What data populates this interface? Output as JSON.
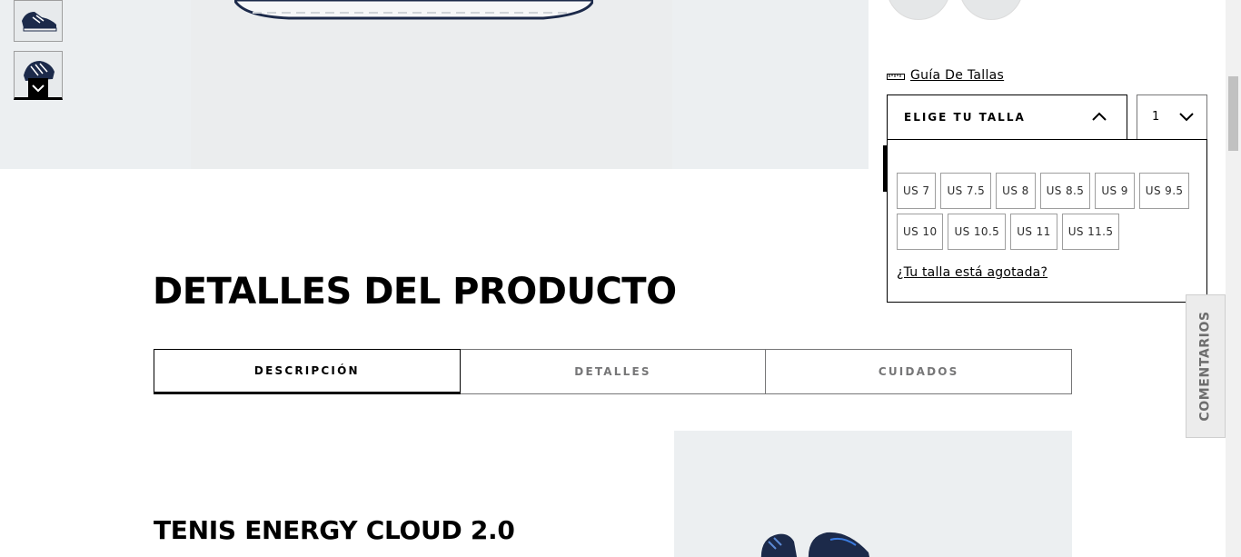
{
  "gallery": {
    "thumbnails": [
      {
        "icon": "shoe-side-icon"
      },
      {
        "icon": "shoe-angle-icon"
      }
    ],
    "scroll_icon": "chevron-down-icon"
  },
  "buy_panel": {
    "size_guide_icon": "ruler-icon",
    "size_guide_label": "Guía De Tallas",
    "size_select_label": "ELIGE TU TALLA",
    "size_select_icon": "chevron-up-icon",
    "quantity_value": "1",
    "quantity_icon": "chevron-down-icon",
    "sizes": [
      "US 7",
      "US 7.5",
      "US 8",
      "US 8.5",
      "US 9",
      "US 9.5",
      "US 10",
      "US 10.5",
      "US 11",
      "US 11.5"
    ],
    "sold_out_link": "¿Tu talla está agotada?"
  },
  "details": {
    "title": "DETALLES DEL PRODUCTO",
    "tabs": [
      {
        "label": "DESCRIPCIÓN",
        "active": true
      },
      {
        "label": "DETALLES",
        "active": false
      },
      {
        "label": "CUIDADOS",
        "active": false
      }
    ],
    "product_name": "TENIS ENERGY CLOUD 2.0"
  },
  "feedback_tab": {
    "label": "COMENTARIOS"
  },
  "colors": {
    "hero_bg": "#eceff1",
    "border_grey": "#767677",
    "shoe_navy": "#1c2a4a"
  }
}
